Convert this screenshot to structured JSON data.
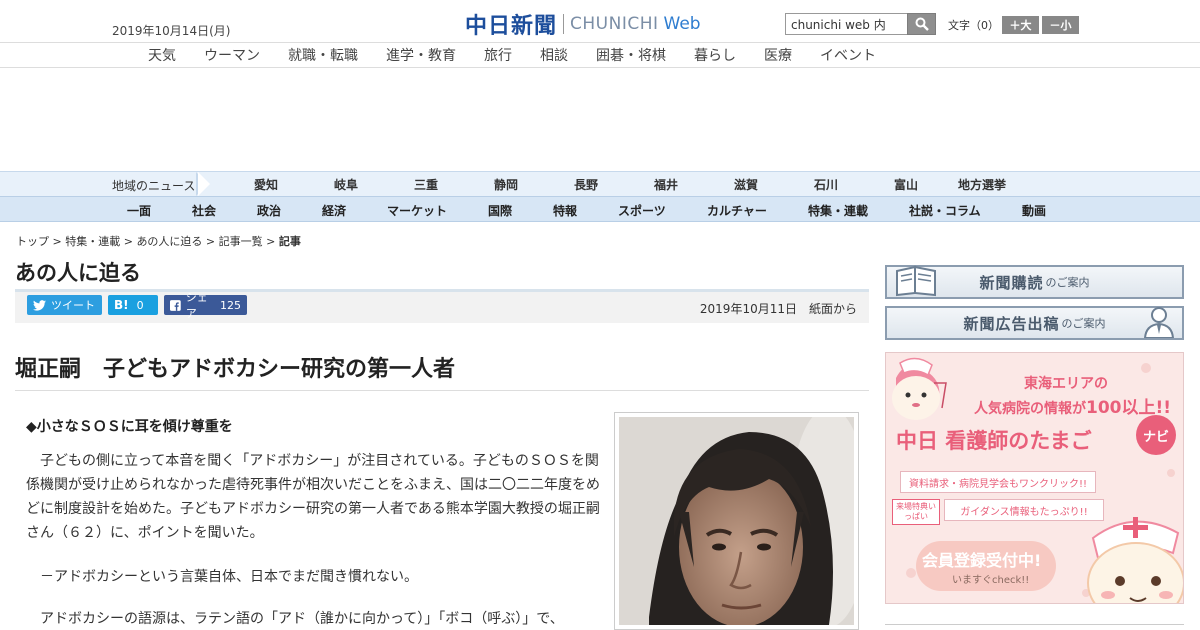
{
  "header": {
    "date": "2019年10月14日(月)",
    "logo_kanji": "中日新聞",
    "logo_latin": "CHUNICHI",
    "logo_web": "Web",
    "search_value": "chunichi web 内",
    "font_size_label": "文字（0）",
    "font_up_label": "＋大",
    "font_down_label": "－小"
  },
  "topnav": [
    "天気",
    "ウーマン",
    "就職・転職",
    "進学・教育",
    "旅行",
    "相談",
    "囲碁・将棋",
    "暮らし",
    "医療",
    "イベント"
  ],
  "regional": {
    "label": "地域のニュース",
    "items": [
      "愛知",
      "岐阜",
      "三重",
      "静岡",
      "長野",
      "福井",
      "滋賀",
      "石川",
      "富山",
      "地方選挙"
    ]
  },
  "categories": [
    "一面",
    "社会",
    "政治",
    "経済",
    "マーケット",
    "国際",
    "特報",
    "スポーツ",
    "カルチャー",
    "特集・連載",
    "社説・コラム",
    "動画"
  ],
  "breadcrumb": {
    "items": [
      "トップ",
      "特集・連載",
      "あの人に迫る",
      "記事一覧"
    ],
    "current": "記事",
    "sep": " > "
  },
  "section_title": "あの人に迫る",
  "share": {
    "tweet": "ツイート",
    "hatena_icon": "B!",
    "hatena_count": "0",
    "facebook": "シェア",
    "facebook_count": "125"
  },
  "pub_date": "2019年10月11日　紙面から",
  "article": {
    "title": "堀正嗣　子どもアドボカシー研究の第一人者",
    "subhead": "◆小さなＳＯＳに耳を傾け尊重を",
    "body": "子どもの側に立って本音を聞く「アドボカシー」が注目されている。子どものＳＯＳを関係機関が受け止められなかった虐待死事件が相次いだことをふまえ、国は二〇二二年度をめどに制度設計を始めた。子どもアドボカシー研究の第一人者である熊本学園大教授の堀正嗣さん（６２）に、ポイントを聞いた。",
    "question": "－アドボカシーという言葉自体、日本でまだ聞き慣れない。",
    "body2": "アドボカシーの語源は、ラテン語の「アド（誰かに向かって）」「ボコ（呼ぶ）」で、"
  },
  "sidebar": {
    "banner1_main": "新聞購読",
    "banner1_sub": "のご案内",
    "banner2_main": "新聞広告出稿",
    "banner2_sub": "のご案内",
    "ad": {
      "line1": "東海エリアの",
      "line2": "人気病院の情報が",
      "line2_em": "100以上!!",
      "brand": "中日 看護師のたまご",
      "brand_tag": "ナビ",
      "feature1": "資料請求・病院見学会もワンクリック!!",
      "badge": "来場特典いっぱい",
      "feature2": "ガイダンス情報もたっぷり!!",
      "cta": "会員登録受付中!",
      "cta_sub": "いますぐcheck!!"
    }
  },
  "colors": {
    "logo_blue": "#1d4e9c",
    "twitter": "#2d9ee0",
    "hatena": "#1aa0e0",
    "facebook": "#3b5998",
    "ad_pink": "#e95f7a"
  }
}
